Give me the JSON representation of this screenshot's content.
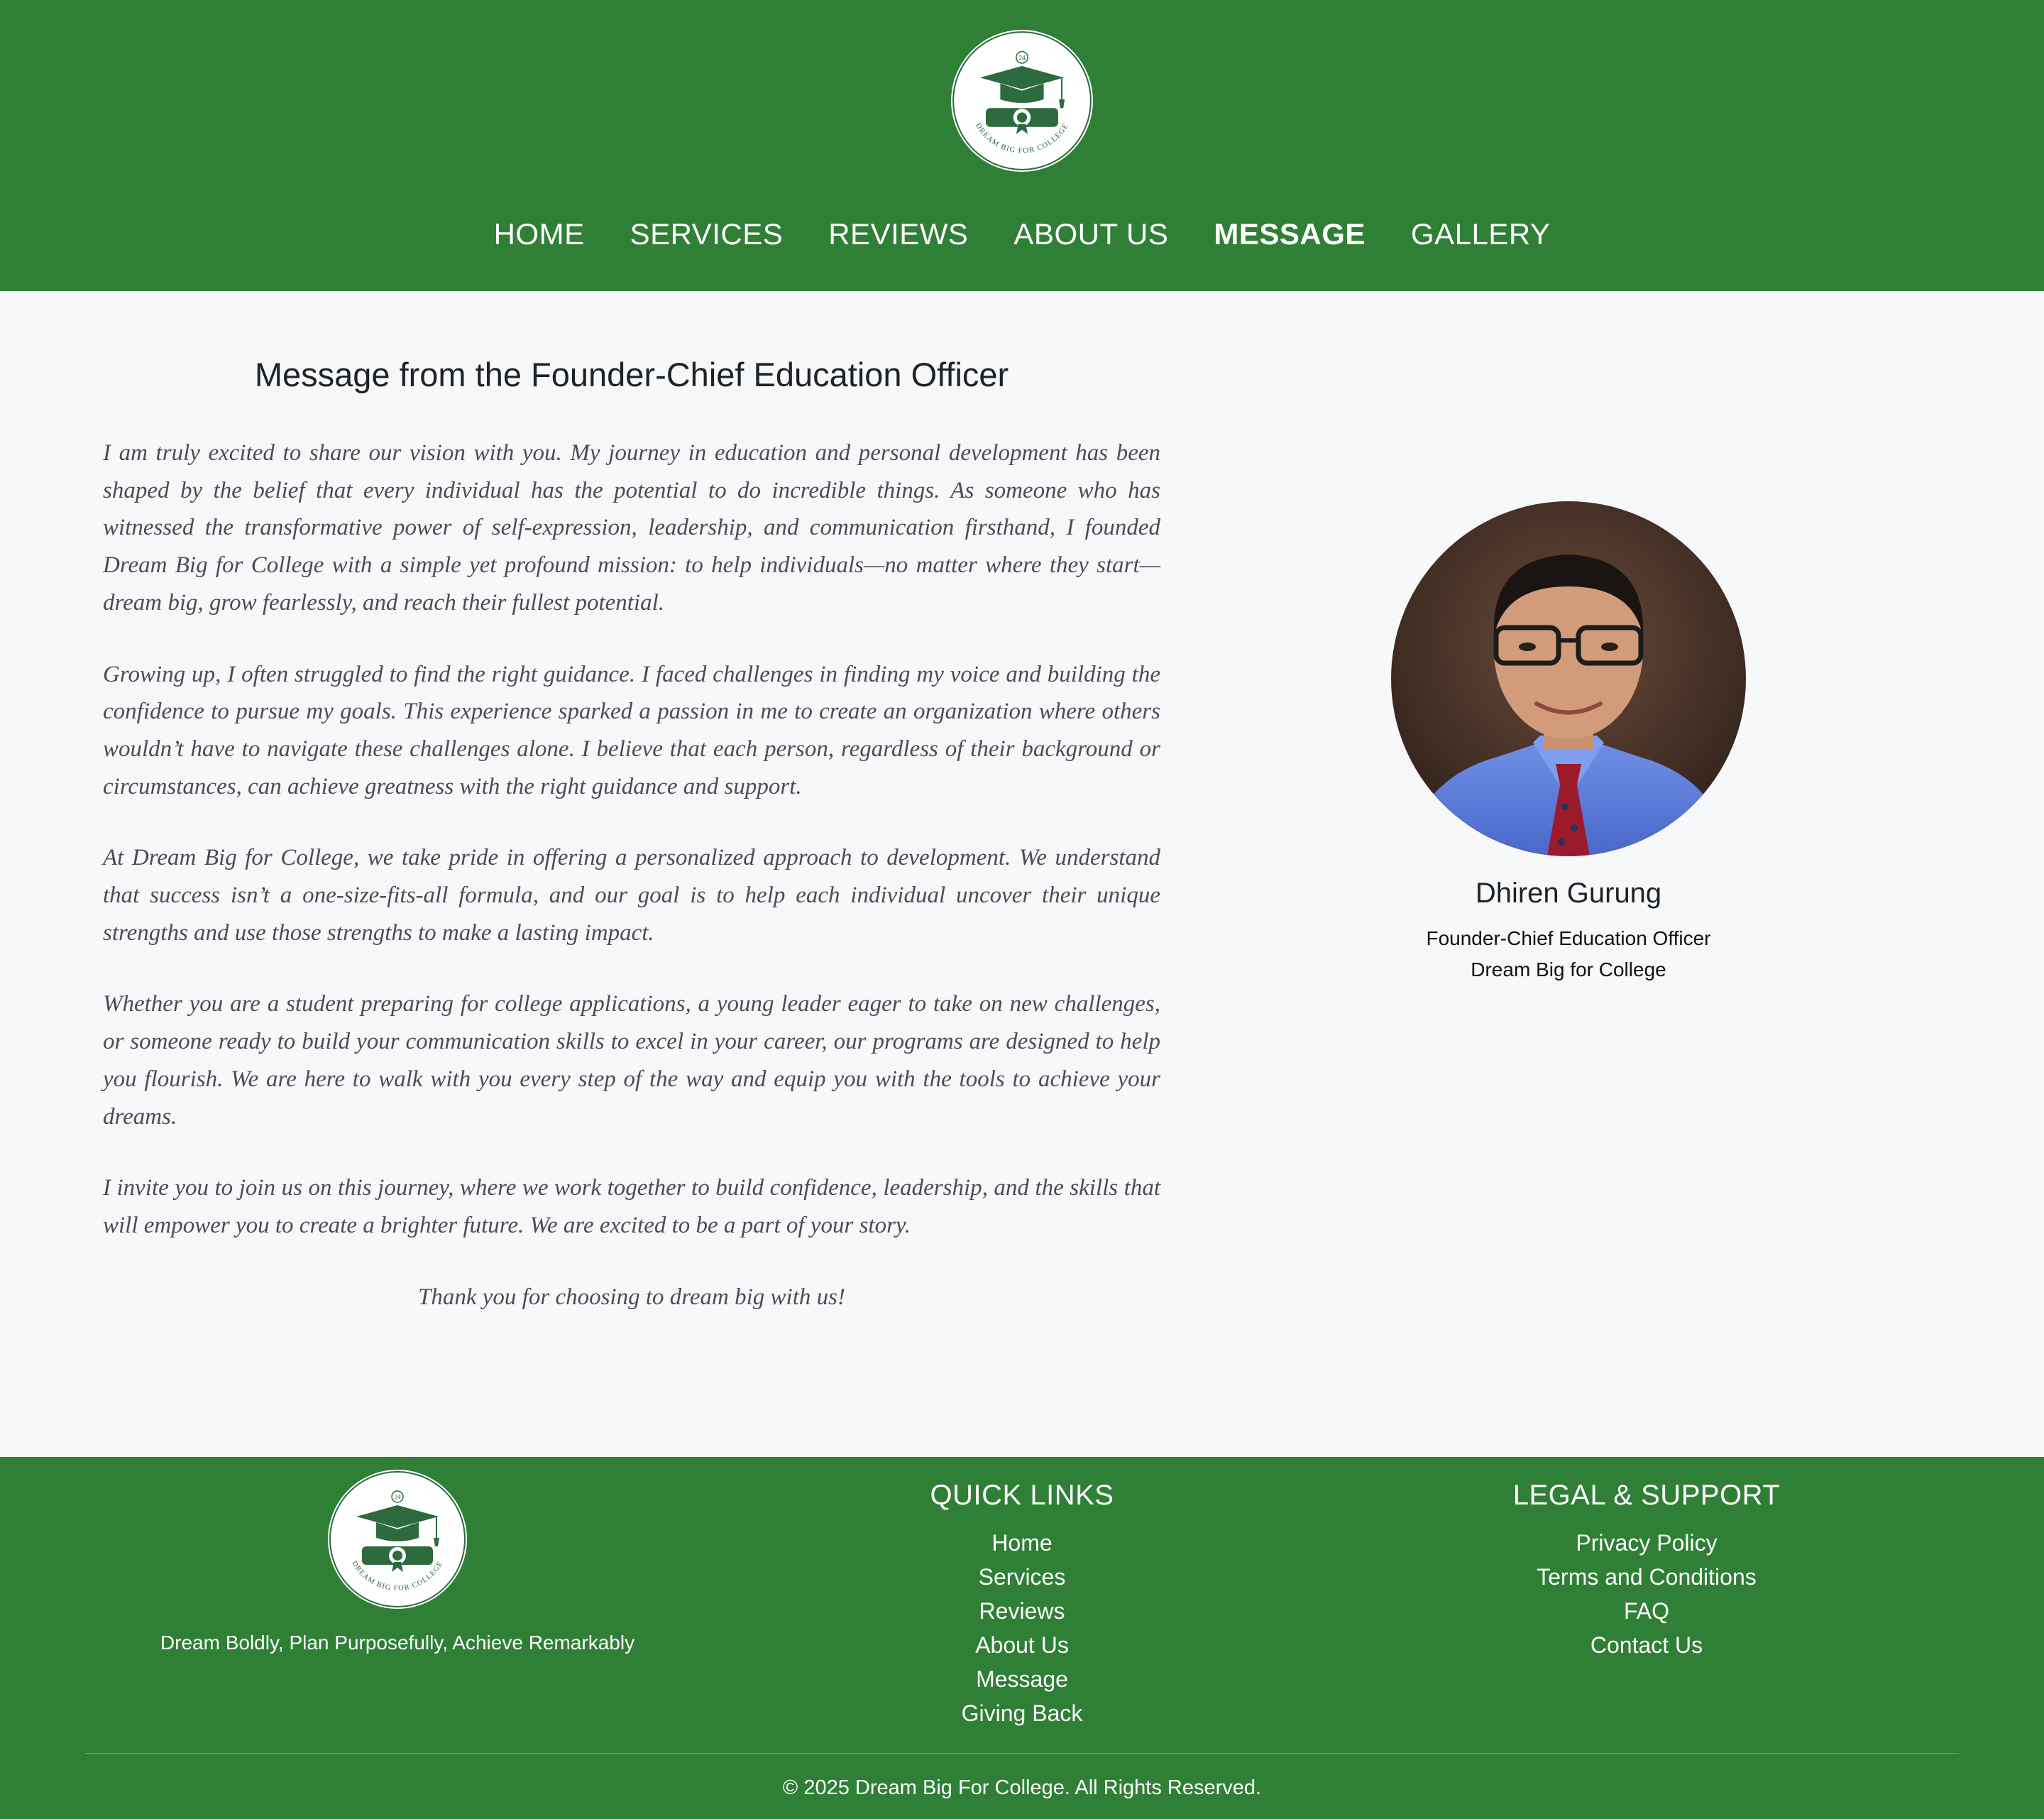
{
  "nav": {
    "items": [
      "HOME",
      "SERVICES",
      "REVIEWS",
      "ABOUT US",
      "MESSAGE",
      "GALLERY"
    ],
    "active": "MESSAGE"
  },
  "logo": {
    "badge": "24",
    "text": "DREAM BIG FOR COLLEGE"
  },
  "main": {
    "title": "Message from the Founder-Chief Education Officer",
    "paragraphs": [
      "I am truly excited to share our vision with you. My journey in education and personal development has been shaped by the belief that every individual has the potential to do incredible things. As someone who has witnessed the transformative power of self-expression, leadership, and communication firsthand, I founded Dream Big for College with a simple yet profound mission: to help individuals—no matter where they start—dream big, grow fearlessly, and reach their fullest potential.",
      "Growing up, I often struggled to find the right guidance. I faced challenges in finding my voice and building the confidence to pursue my goals. This experience sparked a passion in me to create an organization where others wouldn’t have to navigate these challenges alone. I believe that each person, regardless of their background or circumstances, can achieve greatness with the right guidance and support.",
      "At Dream Big for College, we take pride in offering a personalized approach to development. We understand that success isn’t a one-size-fits-all formula, and our goal is to help each individual uncover their unique strengths and use those strengths to make a lasting impact.",
      "Whether you are a student preparing for college applications, a young leader eager to take on new challenges, or someone ready to build your communication skills to excel in your career, our programs are designed to help you flourish. We are here to walk with you every step of the way and equip you with the tools to achieve your dreams.",
      "I invite you to join us on this journey, where we work together to build confidence, leadership, and the skills that will empower you to create a brighter future. We are excited to be a part of your story."
    ],
    "closing": "Thank you for choosing to dream big with us!"
  },
  "founder": {
    "name": "Dhiren Gurung",
    "role": "Founder-Chief Education Officer",
    "org": "Dream Big for College"
  },
  "footer": {
    "tagline": "Dream Boldly, Plan Purposefully, Achieve Remarkably",
    "quick_links_title": "QUICK LINKS",
    "quick_links": [
      "Home",
      "Services",
      "Reviews",
      "About Us",
      "Message",
      "Giving Back"
    ],
    "legal_title": "LEGAL & SUPPORT",
    "legal_links": [
      "Privacy Policy",
      "Terms and Conditions",
      "FAQ",
      "Contact Us"
    ],
    "copyright": "© 2025 Dream Big For College. All Rights Reserved."
  },
  "colors": {
    "brand_green": "#2f7f36",
    "logo_green": "#2d6a3e",
    "page_bg": "#f7f8fa"
  }
}
